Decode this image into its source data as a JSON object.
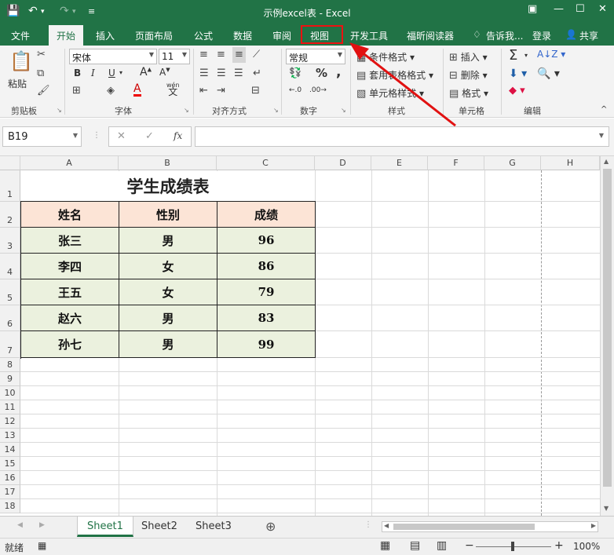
{
  "window": {
    "title": "示例excel表 - Excel"
  },
  "ribbon_tabs": [
    "文件",
    "开始",
    "插入",
    "页面布局",
    "公式",
    "数据",
    "审阅",
    "视图",
    "开发工具",
    "福昕阅读器"
  ],
  "tell_me": "告诉我...",
  "login": "登录",
  "share": "共享",
  "clipboard": {
    "paste": "粘贴",
    "label": "剪贴板"
  },
  "font": {
    "name": "宋体",
    "size": "11",
    "label": "字体",
    "bold": "B",
    "italic": "I",
    "underline": "U",
    "font_color": "A",
    "wen": "wén",
    "wen2": "文"
  },
  "align": {
    "label": "对齐方式"
  },
  "number": {
    "format": "常规",
    "label": "数字",
    "percent": "%",
    "comma": ","
  },
  "styles": {
    "cond": "条件格式",
    "table": "套用表格格式",
    "cell": "单元格样式",
    "label": "样式"
  },
  "cells": {
    "insert": "插入",
    "delete": "删除",
    "format": "格式",
    "label": "单元格"
  },
  "editing": {
    "label": "编辑"
  },
  "formula": {
    "namebox": "B19",
    "fx": "fx",
    "cancel": "✕",
    "confirm": "✓"
  },
  "columns": [
    "A",
    "B",
    "C",
    "D",
    "E",
    "F",
    "G",
    "H"
  ],
  "rows": [
    "1",
    "2",
    "3",
    "4",
    "5",
    "6",
    "7",
    "8",
    "9",
    "10",
    "11",
    "12",
    "13",
    "14",
    "15",
    "16",
    "17",
    "18"
  ],
  "sheet": {
    "title": "学生成绩表",
    "headers": [
      "姓名",
      "性别",
      "成绩"
    ],
    "records": [
      [
        "张三",
        "男",
        "96"
      ],
      [
        "李四",
        "女",
        "86"
      ],
      [
        "王五",
        "女",
        "79"
      ],
      [
        "赵六",
        "男",
        "83"
      ],
      [
        "孙七",
        "男",
        "99"
      ]
    ]
  },
  "sheets": [
    "Sheet1",
    "Sheet2",
    "Sheet3"
  ],
  "status": {
    "ready": "就绪",
    "zoom": "100%",
    "minus": "−",
    "plus": "+"
  },
  "colors": {
    "excel_green": "#217346",
    "header_fill": "#fce4d6",
    "data_fill": "#ebf1de",
    "highlight": "#e11111"
  }
}
